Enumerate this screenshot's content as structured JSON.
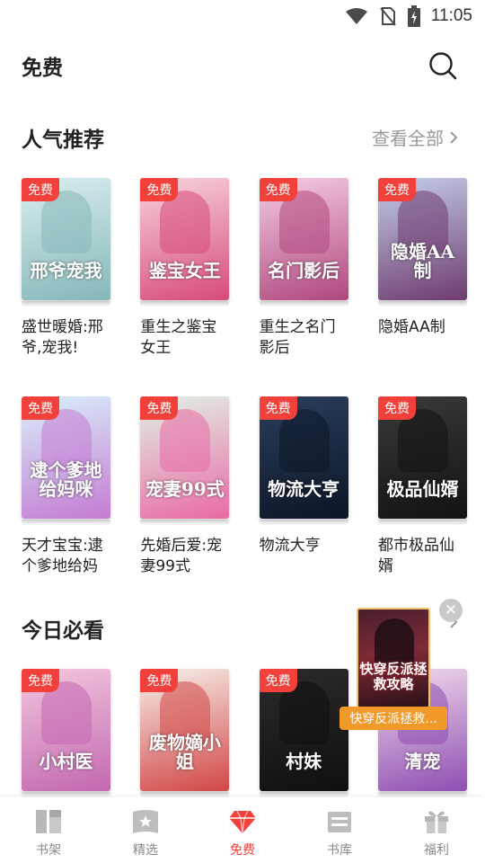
{
  "status_bar": {
    "time": "11:05",
    "icons": [
      "wifi-icon",
      "no-sim-icon",
      "battery-charging-icon"
    ]
  },
  "header": {
    "title": "免费",
    "search_icon": "search-icon"
  },
  "sections": [
    {
      "title": "人气推荐",
      "see_all": "查看全部",
      "books": [
        {
          "badge": "免费",
          "title": "盛世暖婚:邢爷,宠我!",
          "cover_text": "邢爷宠我",
          "colors": [
            "#d9eef0",
            "#86b7b8"
          ]
        },
        {
          "badge": "免费",
          "title": "重生之鉴宝女王",
          "cover_text": "鉴宝女王",
          "colors": [
            "#f7d4dc",
            "#d74b7a"
          ]
        },
        {
          "badge": "免费",
          "title": "重生之名门影后",
          "cover_text": "名门影后",
          "colors": [
            "#f4cde3",
            "#b0487d"
          ]
        },
        {
          "badge": "免费",
          "title": "隐婚AA制",
          "cover_text": "隐婚AA制",
          "colors": [
            "#c5cfe8",
            "#6e3b6f"
          ]
        }
      ]
    },
    {
      "title": "",
      "see_all": "",
      "books": [
        {
          "badge": "免费",
          "title": "天才宝宝:逮个爹地给妈咪",
          "cover_text": "逮个爹地给妈咪",
          "colors": [
            "#d8f0fb",
            "#c47bd1"
          ]
        },
        {
          "badge": "免费",
          "title": "先婚后爱:宠妻99式",
          "cover_text": "宠妻99式",
          "colors": [
            "#e0f2e6",
            "#e96aa4"
          ]
        },
        {
          "badge": "免费",
          "title": "物流大亨",
          "cover_text": "物流大亨",
          "colors": [
            "#2a3e5c",
            "#0d1526"
          ]
        },
        {
          "badge": "免费",
          "title": "都市极品仙婿",
          "cover_text": "极品仙婿",
          "colors": [
            "#3a3a3a",
            "#121212"
          ]
        }
      ]
    },
    {
      "title": "今日必看",
      "see_all": "",
      "books": [
        {
          "badge": "免费",
          "title": "",
          "cover_text": "小村医",
          "colors": [
            "#f3c7de",
            "#c268b0"
          ]
        },
        {
          "badge": "免费",
          "title": "",
          "cover_text": "废物嫡小姐",
          "colors": [
            "#f7f1ec",
            "#d14646"
          ]
        },
        {
          "badge": "免费",
          "title": "",
          "cover_text": "村妹",
          "colors": [
            "#2b2b2b",
            "#0f0f0f"
          ]
        },
        {
          "badge": "",
          "title": "",
          "cover_text": "清宠",
          "colors": [
            "#f3dcec",
            "#8e4fb2"
          ]
        }
      ]
    }
  ],
  "floating_promo": {
    "label": "快穿反派拯救...",
    "cover_text": "快穿反派拯救攻略"
  },
  "bottom_nav": [
    {
      "label": "书架",
      "icon": "bookshelf-icon",
      "active": false
    },
    {
      "label": "精选",
      "icon": "featured-book-icon",
      "active": false
    },
    {
      "label": "免费",
      "icon": "diamond-icon",
      "active": true
    },
    {
      "label": "书库",
      "icon": "library-icon",
      "active": false
    },
    {
      "label": "福利",
      "icon": "gift-icon",
      "active": false
    }
  ],
  "colors": {
    "accent": "#f2403b",
    "promo": "#f19a2a",
    "muted": "#999999"
  }
}
